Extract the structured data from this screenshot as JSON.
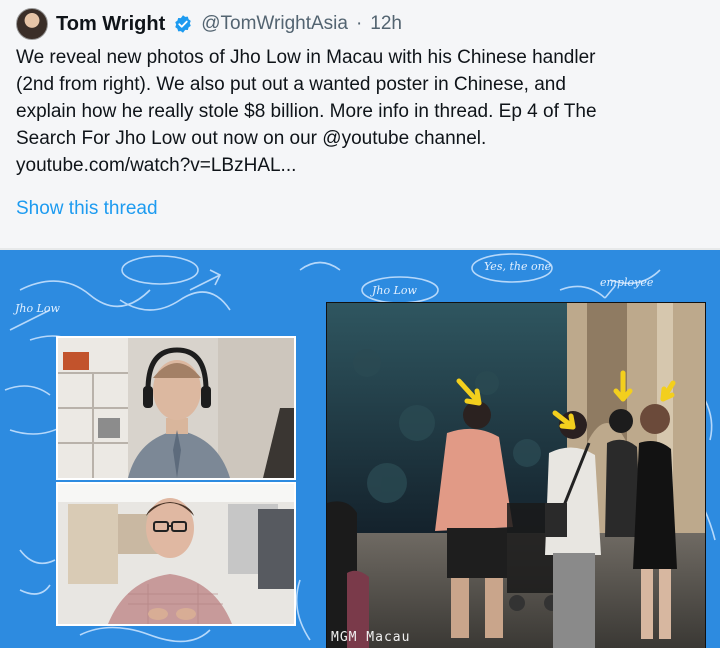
{
  "tweet": {
    "author_name": "Tom Wright",
    "handle": "@TomWrightAsia",
    "separator": "·",
    "time": "12h",
    "text_lines": [
      "We reveal new photos of Jho Low in Macau with his Chinese handler",
      "(2nd from right). We also put out a wanted poster in Chinese, and",
      "explain how he really stole $8 billion. More info in thread. Ep 4 of The",
      "Search For Jho Low out now on our @youtube channel.",
      "youtube.com/watch?v=LBzHAL..."
    ],
    "show_thread_label": "Show this thread"
  },
  "media": {
    "background_color": "#2d8be0",
    "scribbles": [
      "Jho Low",
      "Jho Low",
      "Yes, the one",
      "employee"
    ],
    "photo_watermark": "MGM  Macau"
  },
  "colors": {
    "link": "#1d9bf0",
    "verified": "#1d9bf0",
    "text": "#0f1419",
    "muted": "#536471"
  }
}
